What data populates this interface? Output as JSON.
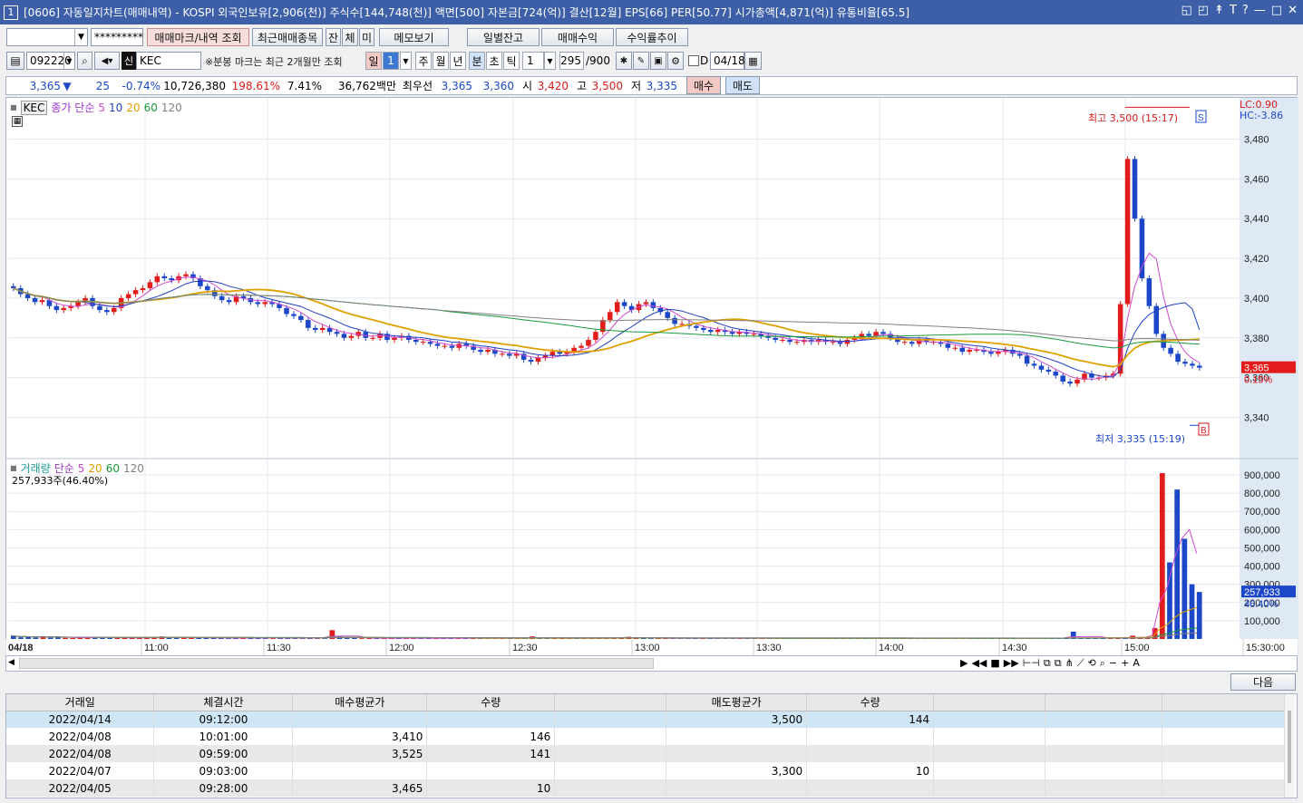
{
  "window": {
    "number": "1",
    "title": "[0606] 자동일지차트(매매내역) - KOSPI 외국인보유[2,906(천)] 주식수[144,748(천)] 액면[500] 자본금[724(억)] 결산[12월] EPS[66] PER[50.77] 시가총액[4,871(억)] 유통비율[65.5]",
    "controls": [
      "◱",
      "◰",
      "↟",
      "T",
      "?",
      "—",
      "□",
      "✕"
    ]
  },
  "toolbar1": {
    "account_value": "",
    "password_mask": "*********",
    "lookup_button": "매매마크/내역 조회",
    "recent_button": "최근매매종목",
    "mode_buttons": [
      "잔",
      "체",
      "미"
    ],
    "memo_button": "메모보기",
    "daily_button": "일별잔고",
    "profit_button": "매매수익",
    "return_button": "수익률추이"
  },
  "toolbar2": {
    "code": "092220",
    "market_badge": "신",
    "name": "KEC",
    "note": "※분봉 마크는 최근 2개월만 조회",
    "period_buttons": [
      "일",
      "주",
      "월",
      "년",
      "분",
      "초",
      "틱"
    ],
    "period_value": "1",
    "period_active": "분",
    "interval_value": "1",
    "count": "295",
    "count_max": "/900",
    "date_check": "D",
    "date": "04/18"
  },
  "ticker": {
    "price": "3,365",
    "arrow": "▼",
    "change": "25",
    "change_pct": "-0.74%",
    "volume": "10,726,380",
    "volume_ratio": "198.61%",
    "turnover": "7.41%",
    "amount": "36,762백만",
    "best_label": "최우선",
    "best_ask": "3,365",
    "best_bid": "3,360",
    "open_label": "시",
    "open": "3,420",
    "high_label": "고",
    "high": "3,500",
    "low_label": "저",
    "low": "3,335",
    "buy_button": "매수",
    "sell_button": "매도"
  },
  "price_panel": {
    "symbol": "KEC",
    "legend_label": "종가 단순",
    "ma_periods": [
      "5",
      "10",
      "20",
      "60",
      "120"
    ],
    "ma_colors": [
      "#d04bd0",
      "#2040c0",
      "#e0a000",
      "#1a9a3a",
      "#808080"
    ],
    "lc": "LC:0.90",
    "hc": "HC:-3.86",
    "high_label": "최고 3,500 (15:17)",
    "low_label": "최저 3,335 (15:19)",
    "sell_mark": "S",
    "buy_mark": "B",
    "current_price": "3,365",
    "current_pct": "0.15%",
    "y_ticks": [
      "3,480",
      "3,460",
      "3,440",
      "3,420",
      "3,400",
      "3,380",
      "3,360",
      "3,340"
    ],
    "y_range": [
      3322,
      3498
    ],
    "series_close": [
      3405,
      3402,
      3400,
      3398,
      3399,
      3396,
      3394,
      3395,
      3396,
      3398,
      3400,
      3396,
      3394,
      3393,
      3395,
      3400,
      3402,
      3404,
      3405,
      3408,
      3411,
      3410,
      3409,
      3411,
      3412,
      3410,
      3406,
      3404,
      3401,
      3399,
      3398,
      3401,
      3400,
      3398,
      3397,
      3398,
      3397,
      3395,
      3392,
      3391,
      3389,
      3385,
      3384,
      3385,
      3383,
      3382,
      3380,
      3381,
      3383,
      3380,
      3380,
      3382,
      3379,
      3380,
      3381,
      3379,
      3378,
      3378,
      3377,
      3376,
      3376,
      3375,
      3377,
      3376,
      3374,
      3373,
      3374,
      3372,
      3372,
      3371,
      3372,
      3369,
      3368,
      3370,
      3371,
      3373,
      3372,
      3373,
      3375,
      3376,
      3379,
      3383,
      3389,
      3393,
      3398,
      3396,
      3394,
      3397,
      3398,
      3395,
      3393,
      3390,
      3387,
      3387,
      3386,
      3385,
      3384,
      3383,
      3384,
      3383,
      3382,
      3383,
      3382,
      3382,
      3381,
      3380,
      3379,
      3379,
      3378,
      3378,
      3379,
      3378,
      3379,
      3378,
      3378,
      3377,
      3379,
      3380,
      3382,
      3381,
      3383,
      3382,
      3380,
      3378,
      3378,
      3377,
      3379,
      3378,
      3378,
      3377,
      3375,
      3375,
      3373,
      3374,
      3374,
      3373,
      3372,
      3373,
      3374,
      3372,
      3371,
      3367,
      3366,
      3364,
      3363,
      3361,
      3358,
      3357,
      3359,
      3362,
      3360,
      3360,
      3361,
      3362,
      3397,
      3470,
      3440,
      3410,
      3396,
      3382,
      3375,
      3372,
      3368,
      3367,
      3366,
      3365
    ]
  },
  "volume_panel": {
    "legend_label": "거래량",
    "legend_ma": "단순",
    "ma_periods": [
      "5",
      "20",
      "60",
      "120"
    ],
    "ma_colors": [
      "#d04bd0",
      "#e0a000",
      "#1a9a3a",
      "#808080"
    ],
    "current": "257,933주(46.40%)",
    "current_value": "257,933",
    "current_pct": "46.40%",
    "y_ticks": [
      "900,000",
      "800,000",
      "700,000",
      "600,000",
      "500,000",
      "400,000",
      "300,000",
      "200,000",
      "100,000"
    ],
    "y_max": 920000,
    "series": [
      18000,
      9000,
      12000,
      8000,
      15000,
      7000,
      10000,
      6000,
      5000,
      9000,
      8000,
      12000,
      7000,
      6000,
      5000,
      10000,
      8000,
      7000,
      6000,
      9000,
      14000,
      11000,
      8000,
      7000,
      6000,
      9000,
      7000,
      5000,
      6000,
      4000,
      5000,
      6000,
      8000,
      5000,
      4000,
      5000,
      6000,
      7000,
      5000,
      4000,
      6000,
      5000,
      4000,
      48000,
      14000,
      6000,
      5000,
      4000,
      5000,
      6000,
      4000,
      3000,
      5000,
      6000,
      4000,
      4000,
      5000,
      3000,
      4000,
      6000,
      5000,
      4000,
      3000,
      5000,
      4000,
      3000,
      4000,
      3000,
      5000,
      4000,
      14000,
      3000,
      4000,
      3000,
      5000,
      4000,
      6000,
      4000,
      3000,
      4000,
      5000,
      6000,
      8000,
      12000,
      7000,
      5000,
      4000,
      3000,
      4000,
      3000,
      4000,
      3000,
      4000,
      5000,
      3000,
      4000,
      3000,
      4000,
      5000,
      3000,
      4000,
      3000,
      3000,
      4000,
      3000,
      4000,
      3000,
      4000,
      3000,
      4000,
      3000,
      3000,
      4000,
      5000,
      3000,
      4000,
      3000,
      4000,
      5000,
      3000,
      4000,
      3000,
      4000,
      3000,
      4000,
      5000,
      3000,
      4000,
      3000,
      4000,
      5000,
      6000,
      4000,
      3000,
      4000,
      5000,
      4000,
      5000,
      6000,
      5000,
      4000,
      5000,
      6000,
      40000,
      7000,
      6000,
      5000,
      7000,
      8000,
      6000,
      5000,
      18000,
      6000,
      8000,
      60000,
      910000,
      420000,
      820000,
      550000,
      300000,
      257933
    ]
  },
  "x_axis": {
    "date": "04/18",
    "times": [
      "11:00",
      "11:30",
      "12:00",
      "12:30",
      "13:00",
      "13:30",
      "14:00",
      "14:30",
      "15:00"
    ],
    "last": "15:30:00"
  },
  "next_button": "다음",
  "trade_table": {
    "headers": [
      "거래일",
      "체결시간",
      "매수평균가",
      "수량",
      "",
      "매도평균가",
      "수량",
      "",
      "",
      ""
    ],
    "rows": [
      [
        "2022/04/14",
        "09:12:00",
        "",
        "",
        "",
        "3,500",
        "144",
        "",
        "",
        ""
      ],
      [
        "2022/04/08",
        "10:01:00",
        "3,410",
        "146",
        "",
        "",
        "",
        "",
        "",
        ""
      ],
      [
        "2022/04/08",
        "09:59:00",
        "3,525",
        "141",
        "",
        "",
        "",
        "",
        "",
        ""
      ],
      [
        "2022/04/07",
        "09:03:00",
        "",
        "",
        "",
        "3,300",
        "10",
        "",
        "",
        ""
      ],
      [
        "2022/04/05",
        "09:28:00",
        "3,465",
        "10",
        "",
        "",
        "",
        "",
        "",
        ""
      ]
    ]
  }
}
